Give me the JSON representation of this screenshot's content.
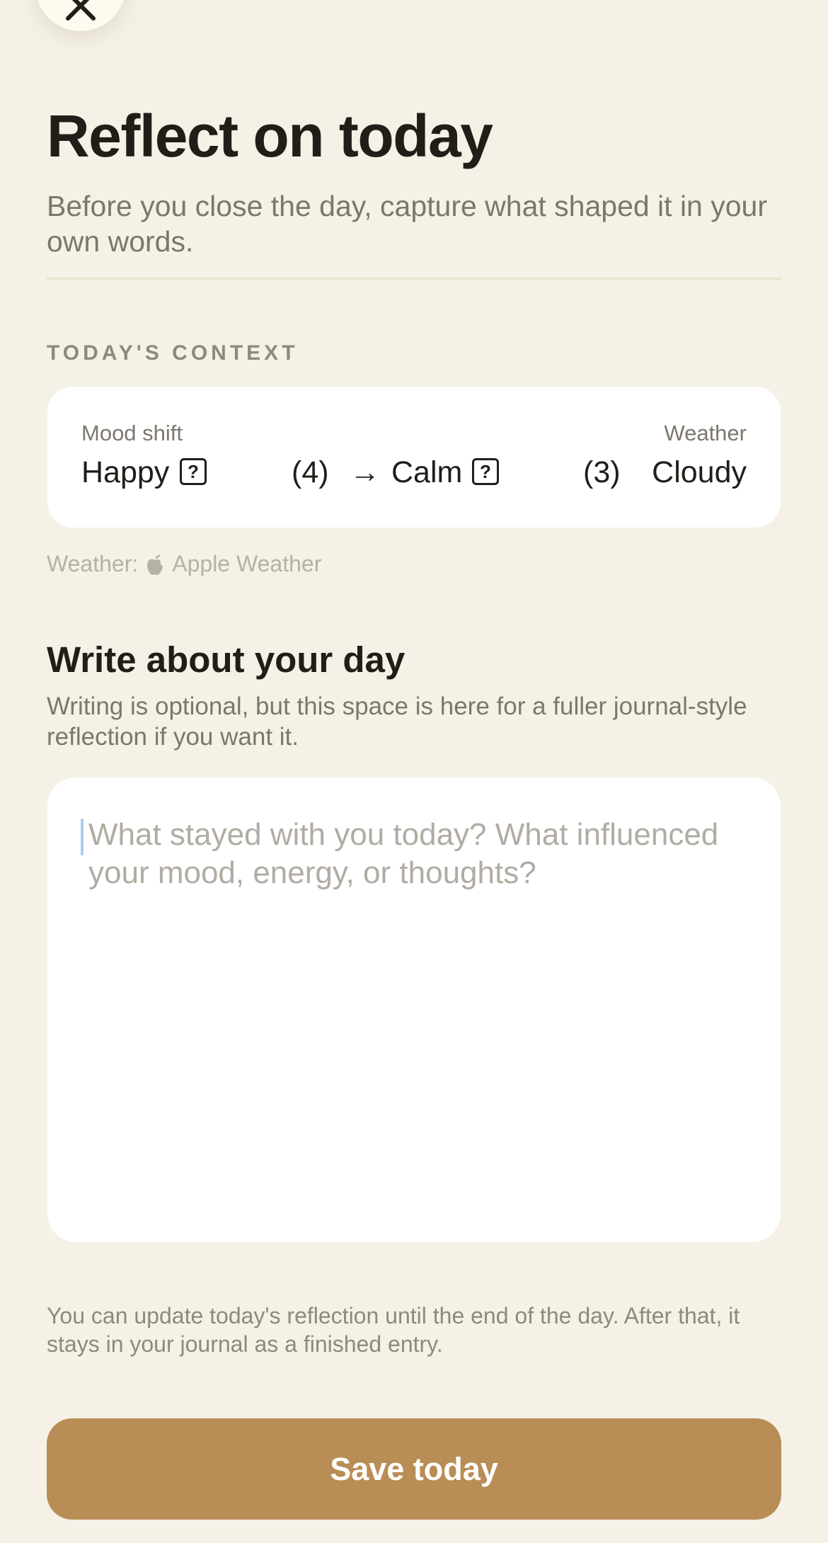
{
  "header": {
    "close_icon": "close-icon",
    "title": "Reflect on today",
    "subtitle": "Before you close the day, capture what shaped it in your own words."
  },
  "context": {
    "section_label": "TODAY'S CONTEXT",
    "mood_shift_label": "Mood shift",
    "weather_label": "Weather",
    "mood_from": "Happy",
    "mood_from_value": "(4)",
    "arrow": "→",
    "mood_to": "Calm",
    "mood_to_value": "(3)",
    "weather_value": "Cloudy",
    "help_icon_glyph": "?",
    "weather_source_prefix": "Weather:",
    "weather_source_name": "Apple Weather",
    "weather_source_icon": "apple-icon"
  },
  "journal": {
    "heading": "Write about your day",
    "description": "Writing is optional, but this space is here for a fuller journal-style reflection if you want it.",
    "placeholder": "What stayed with you today? What influenced your mood, energy, or thoughts?",
    "value": ""
  },
  "footer": {
    "note": "You can update today's reflection until the end of the day. After that, it stays in your journal as a finished entry.",
    "save_label": "Save today"
  },
  "colors": {
    "background": "#f5f1e6",
    "card": "#ffffff",
    "accent": "#b98d56",
    "text_primary": "#211e1a",
    "text_secondary": "#7c776d"
  }
}
